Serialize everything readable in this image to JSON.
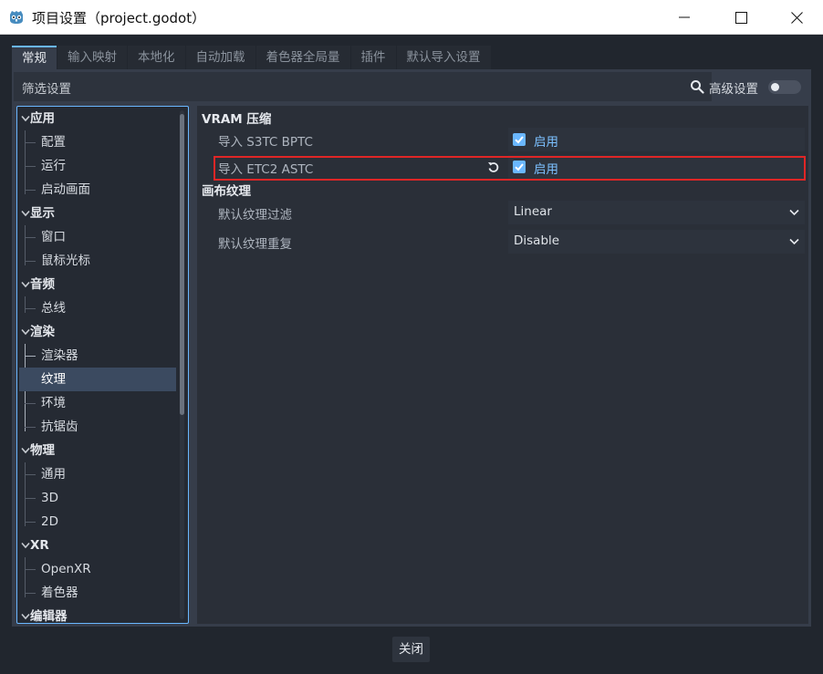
{
  "window": {
    "title": "项目设置（project.godot）"
  },
  "tabs": [
    "常规",
    "输入映射",
    "本地化",
    "自动加载",
    "着色器全局量",
    "插件",
    "默认导入设置"
  ],
  "filter": {
    "placeholder": "筛选设置"
  },
  "advanced": {
    "label": "高级设置",
    "enabled": false
  },
  "tree": {
    "sections": [
      {
        "label": "应用",
        "items": [
          "配置",
          "运行",
          "启动画面"
        ]
      },
      {
        "label": "显示",
        "items": [
          "窗口",
          "鼠标光标"
        ]
      },
      {
        "label": "音频",
        "items": [
          "总线"
        ]
      },
      {
        "label": "渲染",
        "items": [
          "渲染器",
          "纹理",
          "环境",
          "抗锯齿"
        ]
      },
      {
        "label": "物理",
        "items": [
          "通用",
          "3D",
          "2D"
        ]
      },
      {
        "label": "XR",
        "items": [
          "OpenXR",
          "着色器"
        ]
      },
      {
        "label": "编辑器",
        "items": []
      }
    ],
    "selected": "纹理"
  },
  "inspector": {
    "groups": [
      {
        "title": "VRAM 压缩",
        "properties": [
          {
            "label": "导入 S3TC BPTC",
            "type": "checkbox",
            "checked": true,
            "value_label": "启用"
          },
          {
            "label": "导入 ETC2 ASTC",
            "type": "checkbox",
            "checked": true,
            "value_label": "启用",
            "revertable": true,
            "highlighted": true
          }
        ]
      },
      {
        "title": "画布纹理",
        "properties": [
          {
            "label": "默认纹理过滤",
            "type": "select",
            "value": "Linear"
          },
          {
            "label": "默认纹理重复",
            "type": "select",
            "value": "Disable"
          }
        ]
      }
    ]
  },
  "footer": {
    "close_label": "关闭"
  },
  "colors": {
    "accent": "#6ab7ff",
    "highlight_box": "#e02626",
    "panel_bg": "#363d4a",
    "window_bg": "#21262e"
  },
  "icons": [
    "godot-logo-icon",
    "minimize-icon",
    "maximize-icon",
    "close-icon",
    "search-icon",
    "chevron-down-icon",
    "checkmark-icon",
    "revert-icon"
  ]
}
